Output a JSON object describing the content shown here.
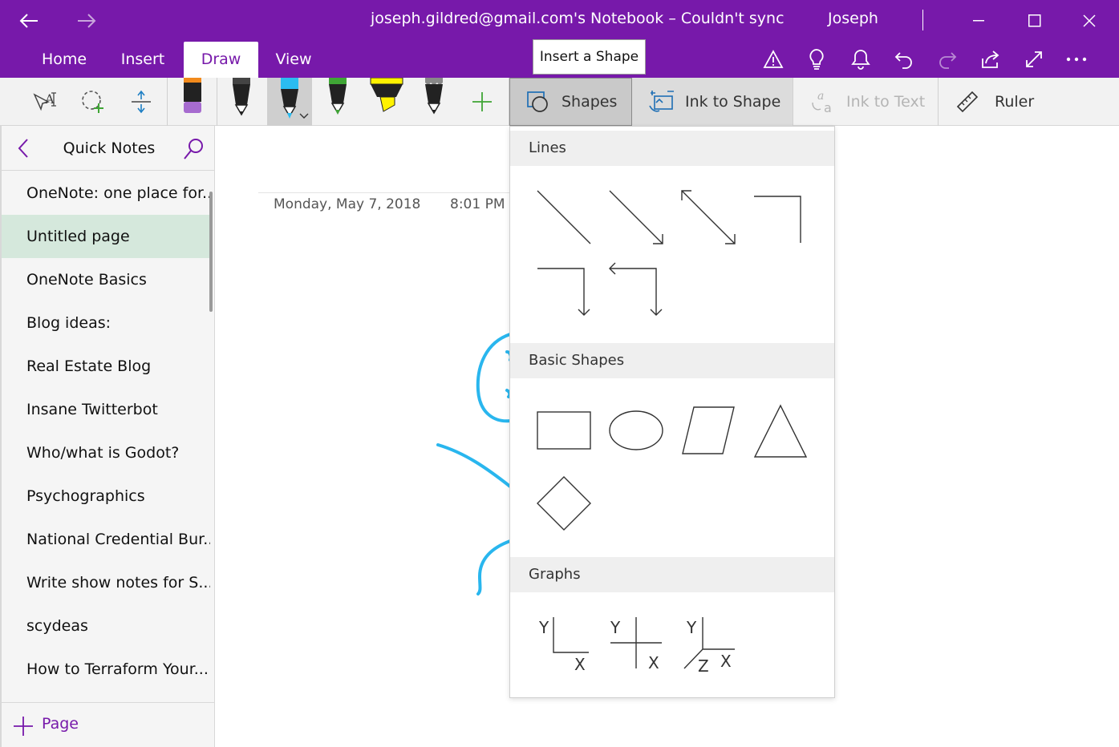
{
  "titlebar": {
    "title": "joseph.gildred@gmail.com's Notebook – Couldn't sync",
    "user": "Joseph",
    "bg_color": "#7719aa"
  },
  "tabs": [
    {
      "label": "Home",
      "active": false
    },
    {
      "label": "Insert",
      "active": false
    },
    {
      "label": "Draw",
      "active": true
    },
    {
      "label": "View",
      "active": false
    }
  ],
  "tooltip": "Insert a Shape",
  "ribbon_icons": [
    "warning-icon",
    "lightbulb-icon",
    "bell-icon",
    "undo-icon",
    "redo-icon",
    "share-icon",
    "fullscreen-icon",
    "more-icon"
  ],
  "toolbar": {
    "pen_colors": [
      "#f28a1c",
      "#222222",
      "#2bbcf0",
      "#3fa535",
      "#fff200",
      "#888888"
    ],
    "shapes_label": "Shapes",
    "ink_to_shape_label": "Ink to Shape",
    "ink_to_text_label": "Ink to Text",
    "ruler_label": "Ruler"
  },
  "sidebar": {
    "section_title": "Quick Notes",
    "pages": [
      "OneNote: one place for...",
      "Untitled page",
      "OneNote Basics",
      "Blog ideas:",
      "Real Estate Blog",
      "Insane Twitterbot",
      "Who/what is Godot?",
      "Psychographics",
      "National Credential Bur...",
      "Write show notes for S...",
      "scydeas",
      "How to Terraform Your..."
    ],
    "selected_index": 1,
    "add_page_label": "Page"
  },
  "page": {
    "date": "Monday, May 7, 2018",
    "time": "8:01 PM",
    "ink_color": "#29b6ee"
  },
  "shapes_panel": {
    "sections": [
      {
        "title": "Lines",
        "items": [
          "line",
          "arrow",
          "double-arrow",
          "elbow-line",
          "elbow-arrow",
          "elbow-double-arrow"
        ]
      },
      {
        "title": "Basic Shapes",
        "items": [
          "rectangle",
          "ellipse",
          "parallelogram",
          "triangle",
          "diamond"
        ]
      },
      {
        "title": "Graphs",
        "items": [
          "graph-xy",
          "graph-cross",
          "graph-3d"
        ]
      }
    ],
    "graph_axis_labels": {
      "x": "X",
      "y": "Y",
      "z": "Z"
    }
  }
}
